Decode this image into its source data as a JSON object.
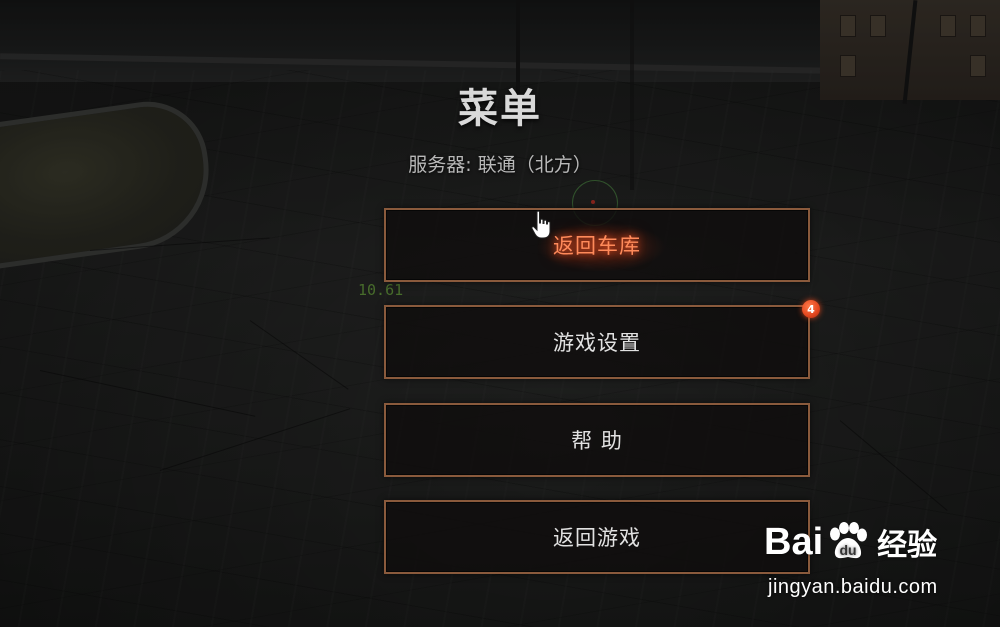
{
  "menu": {
    "title": "菜单",
    "server_line": "服务器: 联通（北方）",
    "buttons": [
      {
        "label": "返回车库",
        "state": "hover"
      },
      {
        "label": "游戏设置",
        "badge": "4"
      },
      {
        "label": "帮 助"
      },
      {
        "label": "返回游戏"
      }
    ]
  },
  "hud": {
    "timer": "10.61"
  },
  "watermark": {
    "logo_text": "Bai",
    "logo_text_2": "u",
    "logo_suffix": "经验",
    "url": "jingyan.baidu.com"
  },
  "colors": {
    "button_border": "#8a5a3c",
    "active_text": "#ff8a5a",
    "badge": "#e2461e",
    "title": "#d9d9d9"
  },
  "icons": {
    "cursor": "hand-pointer-icon",
    "badge": "notification-badge",
    "watermark": "baidu-paw-icon"
  }
}
